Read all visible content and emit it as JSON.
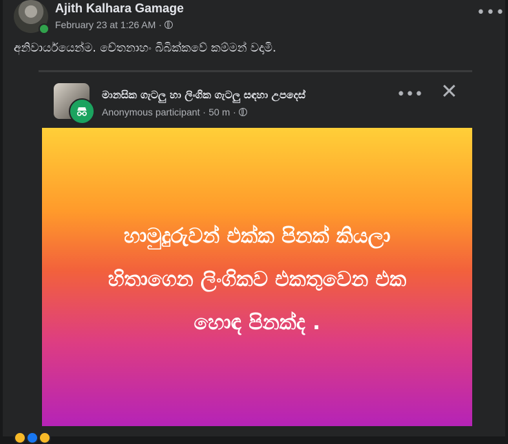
{
  "post": {
    "author": "Ajith Kalhara Gamage",
    "timestamp": "February 23 at 1:26 AM",
    "separator": "·",
    "privacy_icon": "globe-icon",
    "more_icon": "more-horizontal-icon",
    "more_label": "•••",
    "caption": "අනිවාර්යයෙන්ම. චේතනාහං බිබික්කවේ කම්මන් වදාමි."
  },
  "shared": {
    "group_name": "මානසික ගැටලු හා ලිංගික ගැටලු සඳහා උපදෙස්",
    "author": "Anonymous participant",
    "time": "50 m",
    "separator": "·",
    "privacy_icon": "globe-icon",
    "more_label": "•••",
    "close_label": "✕",
    "image_text_lines": [
      "හාමුදුරුවන් එක්ක පිනක් කියලා",
      "හිතාගෙන ලිංගිකව එකතුවෙන එක",
      "හොඳ පිනක්ද ."
    ]
  },
  "colors": {
    "background": "#18191a",
    "card": "#242526",
    "online": "#31a24c",
    "anonymous_badge": "#1ba35f",
    "gradient_top": "#ffcf38",
    "gradient_bottom": "#b523b7"
  }
}
